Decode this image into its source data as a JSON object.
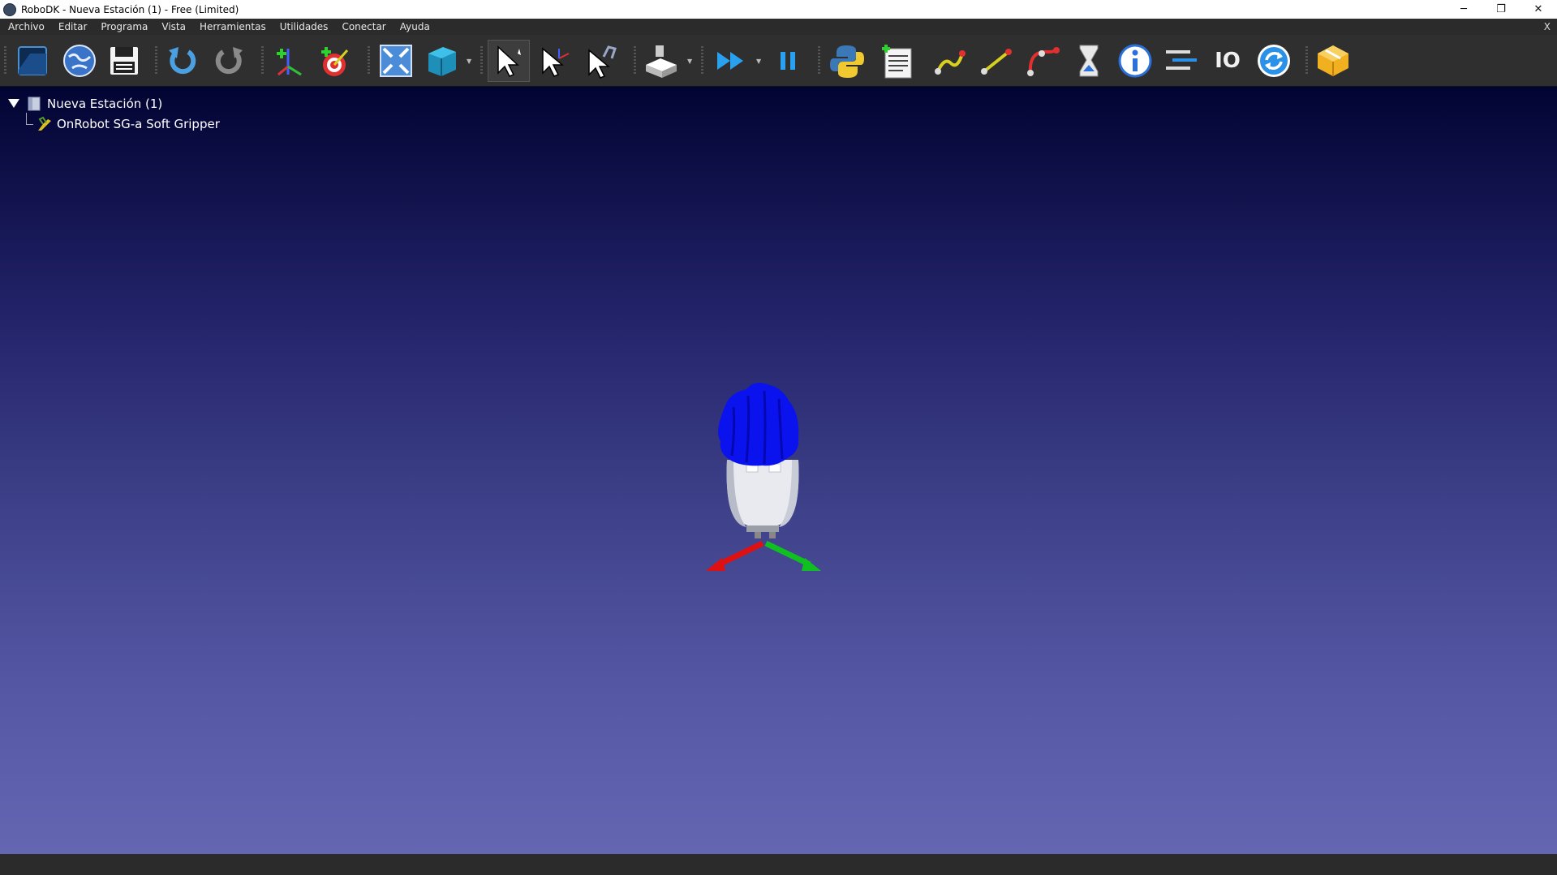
{
  "window": {
    "title": "RoboDK - Nueva Estación (1) - Free (Limited)",
    "minimize": "─",
    "maximize": "❐",
    "close": "✕"
  },
  "menu": {
    "items": [
      "Archivo",
      "Editar",
      "Programa",
      "Vista",
      "Herramientas",
      "Utilidades",
      "Conectar",
      "Ayuda"
    ],
    "close": "X"
  },
  "toolbar": {
    "icons": [
      "open-icon",
      "online-library-icon",
      "save-icon",
      "undo-icon",
      "redo-icon",
      "add-reference-frame-icon",
      "add-target-icon",
      "fit-all-icon",
      "view-cube-icon",
      "select-icon",
      "move-reference-icon",
      "move-tool-icon",
      "teach-tool-icon",
      "fast-forward-icon",
      "pause-icon",
      "python-icon",
      "add-program-icon",
      "joint-move-icon",
      "linear-move-icon",
      "circular-move-icon",
      "pause-instruction-icon",
      "message-icon",
      "set-speed-icon",
      "io-icon",
      "loop-icon",
      "add-ons-icon"
    ],
    "io_label": "IO"
  },
  "tree": {
    "station": "Nueva Estación (1)",
    "tool": "OnRobot SG-a Soft Gripper"
  },
  "colors": {
    "gripper_blue": "#0a12ee",
    "gripper_body": "#e8eaf0",
    "axis_x": "#e01010",
    "axis_y": "#10c020"
  }
}
